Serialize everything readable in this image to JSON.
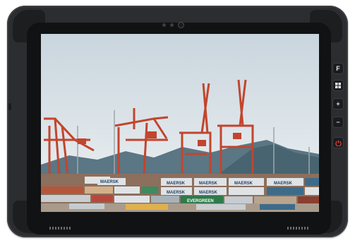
{
  "device": {
    "buttons": [
      {
        "label": "F",
        "icon": "f-key-icon"
      },
      {
        "label": "",
        "icon": "windows-icon"
      },
      {
        "label": "+",
        "icon": "plus-icon"
      },
      {
        "label": "−",
        "icon": "minus-icon"
      },
      {
        "label": "",
        "icon": "power-icon"
      }
    ]
  },
  "scene": {
    "container_labels": [
      "MAERSK",
      "MAERSK",
      "MAERSK",
      "MAERSK",
      "MAERSK",
      "MAERSK",
      "MAERSK",
      "EVERGREEN"
    ],
    "colors": {
      "sky": "#e3ebef",
      "mountain": "#4c6a78",
      "crane": "#c2452d",
      "maersk_container": "#dfe3e6",
      "evergreen_container": "#2f7a4a"
    }
  }
}
